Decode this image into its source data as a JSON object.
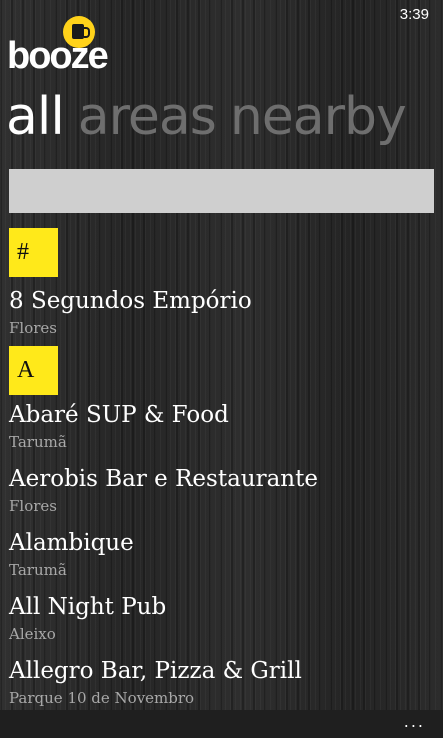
{
  "status": {
    "time": "3:39"
  },
  "app": {
    "logo_text": "booze",
    "logo_icon": "beer-mug-icon"
  },
  "pivot": {
    "tabs": [
      {
        "label": "all",
        "active": true
      },
      {
        "label": "areas",
        "active": false
      },
      {
        "label": "nearby",
        "active": false
      }
    ]
  },
  "search": {
    "value": ""
  },
  "groups": [
    {
      "letter": "#",
      "items": [
        {
          "name": "8 Segundos Empório",
          "area": "Flores"
        }
      ]
    },
    {
      "letter": "A",
      "items": [
        {
          "name": "Abaré SUP & Food",
          "area": "Tarumã"
        },
        {
          "name": "Aerobis Bar e Restaurante",
          "area": "Flores"
        },
        {
          "name": "Alambique",
          "area": "Tarumã"
        },
        {
          "name": "All Night Pub",
          "area": "Aleixo"
        },
        {
          "name": "Allegro Bar, Pizza & Grill",
          "area": "Parque 10 de Novembro"
        }
      ]
    }
  ],
  "app_bar": {
    "more_label": "..."
  },
  "colors": {
    "accent": "#ffe91a",
    "logo_badge": "#ffd21a",
    "inactive_tab": "#6e6e6e"
  }
}
